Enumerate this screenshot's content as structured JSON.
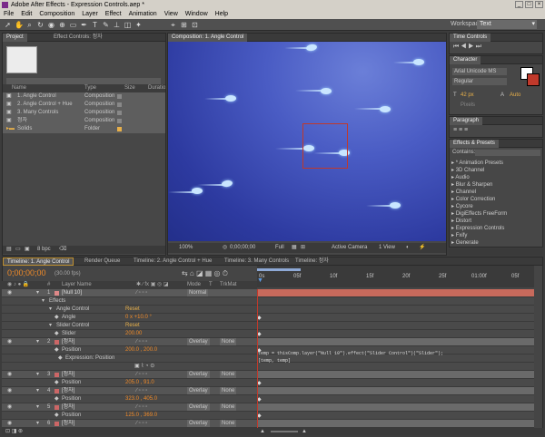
{
  "window": {
    "title": "Adobe After Effects - Expression Controls.aep *",
    "buttons": [
      "_",
      "□",
      "×"
    ]
  },
  "menu": [
    "File",
    "Edit",
    "Composition",
    "Layer",
    "Effect",
    "Animation",
    "View",
    "Window",
    "Help"
  ],
  "workspace": {
    "label": "Workspace:",
    "value": "Text"
  },
  "project": {
    "tabs": [
      "Project",
      "Effect Controls: 정자"
    ],
    "cols": [
      "Name",
      "Type",
      "Size",
      "Duration"
    ],
    "items": [
      {
        "name": "1. Angle Control",
        "type": "Composition"
      },
      {
        "name": "2. Angle Control + Hue",
        "type": "Composition"
      },
      {
        "name": "3. Many Controls",
        "type": "Composition"
      },
      {
        "name": "정자",
        "type": "Composition"
      },
      {
        "name": "Solids",
        "type": "Folder"
      }
    ],
    "bpc": "8 bpc"
  },
  "composition": {
    "tab": "Composition: 1. Angle Control",
    "zoom": "100%",
    "time": "0;00;00;00",
    "res": "Full",
    "camera": "Active Camera",
    "views": "1 View"
  },
  "time_controls": {
    "tab": "Time Controls"
  },
  "character": {
    "tab": "Character",
    "font": "Arial Unicode MS",
    "style": "Regular",
    "size": "42 px",
    "leading": "Auto",
    "tracking_unit": "Pixels"
  },
  "paragraph": {
    "tab": "Paragraph"
  },
  "effects": {
    "tab": "Effects & Presets",
    "contains": "Contains:",
    "items": [
      "* Animation Presets",
      "3D Channel",
      "Audio",
      "Blur & Sharpen",
      "Channel",
      "Color Correction",
      "Cycore",
      "DigiEffects FreeForm",
      "Distort",
      "Expression Controls",
      "Fxify",
      "Generate"
    ]
  },
  "timeline": {
    "tabs": [
      "Timeline: 1. Angle Control",
      "Render Queue",
      "Timeline: 2. Angle Control + Hue",
      "Timeline: 3. Many Controls",
      "Timeline: 정자"
    ],
    "time": "0;00;00;00",
    "fps": "(30.00 fps)",
    "cols": {
      "num": "#",
      "name": "Layer Name",
      "mode": "Mode",
      "trkmat": "TrkMat",
      "t": "T"
    },
    "ruler": [
      "0s",
      "05f",
      "10f",
      "15f",
      "20f",
      "25f",
      "01:00f",
      "05f"
    ],
    "rows": [
      {
        "k": "layer",
        "n": "1",
        "name": "[Null 10]",
        "mode": "Normal"
      },
      {
        "k": "group",
        "name": "Effects"
      },
      {
        "k": "fx",
        "name": "Angle Control",
        "val": "Reset"
      },
      {
        "k": "prop",
        "name": "Angle",
        "val": "0 x +10.0 °"
      },
      {
        "k": "fx",
        "name": "Slider Control",
        "val": "Reset"
      },
      {
        "k": "prop",
        "name": "Slider",
        "val": "200.00"
      },
      {
        "k": "layer",
        "n": "2",
        "name": "[정자]",
        "mode": "Overlay",
        "trk": "None"
      },
      {
        "k": "prop",
        "name": "Position",
        "val": "200.0 , 200.0"
      },
      {
        "k": "expr",
        "name": "Expression: Position"
      },
      {
        "k": "blank"
      },
      {
        "k": "layer",
        "n": "3",
        "name": "[정자]",
        "mode": "Overlay",
        "trk": "None"
      },
      {
        "k": "prop",
        "name": "Position",
        "val": "205.0 , 91.0"
      },
      {
        "k": "layer",
        "n": "4",
        "name": "[정자]",
        "mode": "Overlay",
        "trk": "None"
      },
      {
        "k": "prop",
        "name": "Position",
        "val": "323.0 , 405.0"
      },
      {
        "k": "layer",
        "n": "5",
        "name": "[정자]",
        "mode": "Overlay",
        "trk": "None"
      },
      {
        "k": "prop",
        "name": "Position",
        "val": "125.0 , 369.0"
      },
      {
        "k": "layer",
        "n": "6",
        "name": "[정자]",
        "mode": "Overlay",
        "trk": "None"
      }
    ],
    "expression_text": [
      "temp = thisComp.layer(\"Null 10\").effect(\"Slider Control\")(\"Slider\");",
      "[temp, temp]"
    ]
  }
}
